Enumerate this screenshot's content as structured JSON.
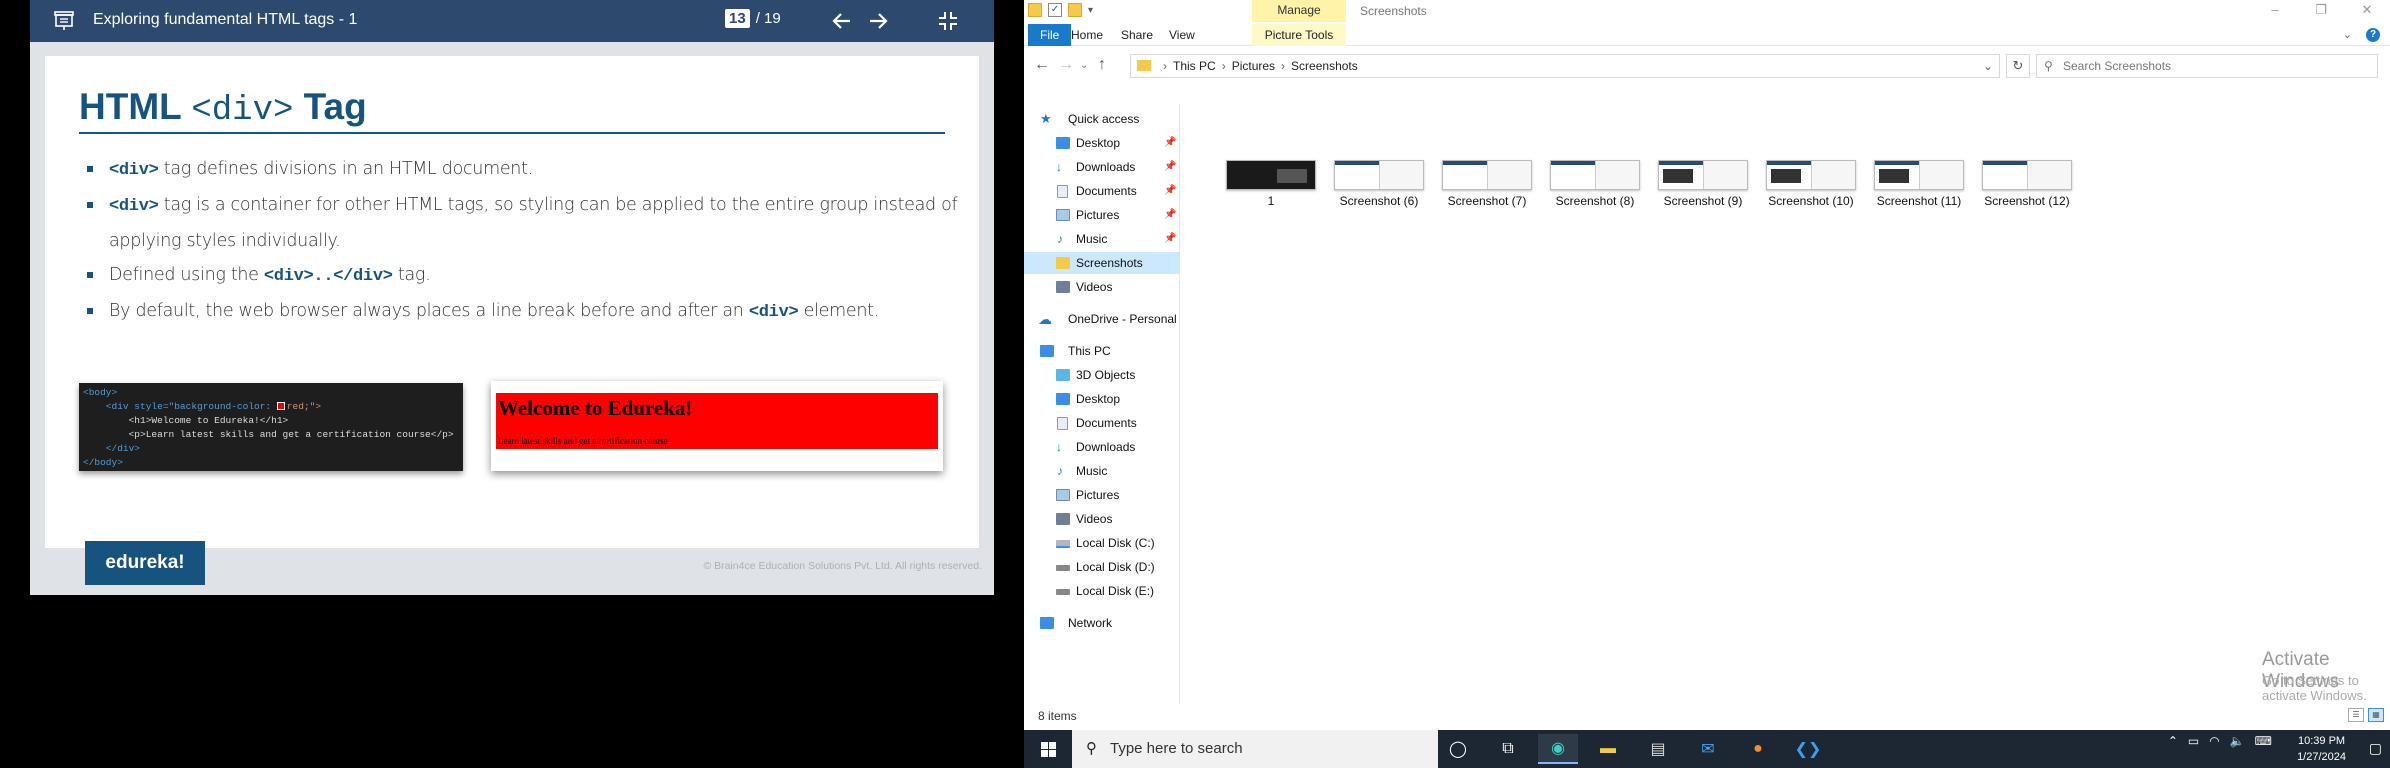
{
  "viewer": {
    "title": "Exploring fundamental HTML tags - 1",
    "page_current": "13",
    "page_total": "/ 19"
  },
  "slide": {
    "heading_pre": "HTML ",
    "heading_code": "<div>",
    "heading_post": " Tag",
    "bullets": [
      {
        "code": "<div>",
        "text": " tag defines divisions in an HTML document."
      },
      {
        "code": "<div>",
        "text": " tag is a container for other HTML tags, so styling can be applied to the entire group instead of applying styles individually."
      },
      {
        "pre": "Defined using the ",
        "code": "<div>..</div>",
        "text": " tag."
      },
      {
        "pre": "By default, the web browser always places a line break before and after an ",
        "code": "<div>",
        "text": " element."
      }
    ],
    "code_lines": [
      "<body>",
      "    <div style=\"background-color: ",
      "red;\">",
      "        <h1>Welcome to Edureka!</h1>",
      "        <p>Learn latest skills and get a certification course</p>",
      "    </div>",
      "</body>"
    ],
    "render_heading": "Welcome to Edureka!",
    "render_para": "Learn latest skills and get a certification course",
    "brand": "edureka!",
    "copyright": "© Brain4ce Education Solutions Pvt. Ltd. All rights reserved."
  },
  "explorer": {
    "title": "Screenshots",
    "manage_tab": "Manage",
    "ribbon_tabs": [
      "File",
      "Home",
      "Share",
      "View",
      "Picture Tools"
    ],
    "breadcrumb": [
      "This PC",
      "Pictures",
      "Screenshots"
    ],
    "search_placeholder": "Search Screenshots",
    "nav": {
      "quick_access": "Quick access",
      "quick_items": [
        "Desktop",
        "Downloads",
        "Documents",
        "Pictures",
        "Music",
        "Screenshots",
        "Videos"
      ],
      "onedrive": "OneDrive - Personal",
      "this_pc": "This PC",
      "pc_items": [
        "3D Objects",
        "Desktop",
        "Documents",
        "Downloads",
        "Music",
        "Pictures",
        "Videos",
        "Local Disk (C:)",
        "Local Disk (D:)",
        "Local Disk (E:)"
      ],
      "network": "Network"
    },
    "files": [
      "1",
      "Screenshot (6)",
      "Screenshot (7)",
      "Screenshot (8)",
      "Screenshot (9)",
      "Screenshot (10)",
      "Screenshot (11)",
      "Screenshot (12)"
    ],
    "status_count": "8 items",
    "watermark_title": "Activate Windows",
    "watermark_sub": "Go to Settings to activate Windows."
  },
  "taskbar": {
    "search_placeholder": "Type here to search",
    "time": "10:39 PM",
    "date": "1/27/2024"
  }
}
